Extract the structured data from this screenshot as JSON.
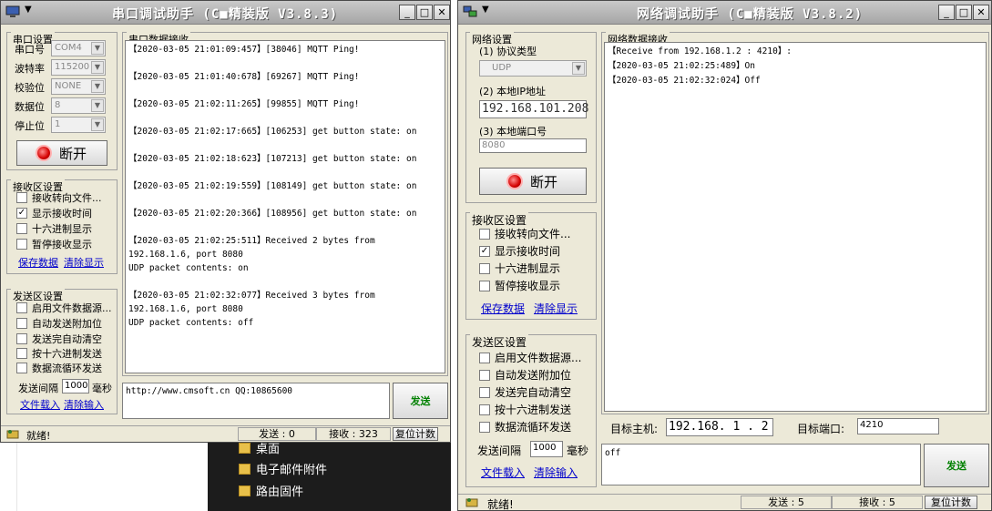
{
  "explorer": {
    "items": [
      "桌面",
      "电子邮件附件",
      "路由固件"
    ]
  },
  "serial": {
    "title": "串口调试助手  (C■精装版 V3.8.3)",
    "settings_title": "串口设置",
    "port_label": "串口号",
    "port_value": "COM4",
    "baud_label": "波特率",
    "baud_value": "115200",
    "parity_label": "校验位",
    "parity_value": "NONE",
    "data_label": "数据位",
    "data_value": "8",
    "stop_label": "停止位",
    "stop_value": "1",
    "open_button": "断开",
    "recv_title": "接收区设置",
    "recv_options": [
      {
        "label": "接收转向文件...",
        "checked": ""
      },
      {
        "label": "显示接收时间",
        "checked": "✓"
      },
      {
        "label": "十六进制显示",
        "checked": ""
      },
      {
        "label": "暂停接收显示",
        "checked": ""
      }
    ],
    "save_data": "保存数据",
    "clear_display": "清除显示",
    "send_title": "发送区设置",
    "send_options": [
      {
        "label": "启用文件数据源...",
        "checked": ""
      },
      {
        "label": "自动发送附加位",
        "checked": ""
      },
      {
        "label": "发送完自动清空",
        "checked": ""
      },
      {
        "label": "按十六进制发送",
        "checked": ""
      },
      {
        "label": "数据流循环发送",
        "checked": ""
      }
    ],
    "interval_label": "发送间隔",
    "interval_value": "1000",
    "interval_unit": "毫秒",
    "load_file": "文件载入",
    "clear_input": "清除输入",
    "data_title": "串口数据接收",
    "log": "【2020-03-05 21:01:09:457】[38046] MQTT Ping!\n\n【2020-03-05 21:01:40:678】[69267] MQTT Ping!\n\n【2020-03-05 21:02:11:265】[99855] MQTT Ping!\n\n【2020-03-05 21:02:17:665】[106253] get button state: on\n\n【2020-03-05 21:02:18:623】[107213] get button state: on\n\n【2020-03-05 21:02:19:559】[108149] get button state: on\n\n【2020-03-05 21:02:20:366】[108956] get button state: on\n\n【2020-03-05 21:02:25:511】Received 2 bytes from\n192.168.1.6, port 8080\nUDP packet contents: on\n\n【2020-03-05 21:02:32:077】Received 3 bytes from\n192.168.1.6, port 8080\nUDP packet contents: off",
    "send_text": "http://www.cmsoft.cn QQ:10865600",
    "send_button": "发送",
    "status": "就绪!",
    "sent_label": "发送 : 0",
    "recv_label": "接收 : 323",
    "reset_button": "复位计数"
  },
  "net": {
    "title": "网络调试助手  (C■精装版 V3.8.2)",
    "settings_title": "网络设置",
    "protocol_label": "(1) 协议类型",
    "protocol_value": "UDP",
    "ip_label": "(2) 本地IP地址",
    "ip_value": "192.168.101.208",
    "port_label": "(3) 本地端口号",
    "port_value": "8080",
    "open_button": "断开",
    "recv_title": "接收区设置",
    "recv_options": [
      {
        "label": "接收转向文件...",
        "checked": ""
      },
      {
        "label": "显示接收时间",
        "checked": "✓"
      },
      {
        "label": "十六进制显示",
        "checked": ""
      },
      {
        "label": "暂停接收显示",
        "checked": ""
      }
    ],
    "save_data": "保存数据",
    "clear_display": "清除显示",
    "send_title": "发送区设置",
    "send_options": [
      {
        "label": "启用文件数据源...",
        "checked": ""
      },
      {
        "label": "自动发送附加位",
        "checked": ""
      },
      {
        "label": "发送完自动清空",
        "checked": ""
      },
      {
        "label": "按十六进制发送",
        "checked": ""
      },
      {
        "label": "数据流循环发送",
        "checked": ""
      }
    ],
    "interval_label": "发送间隔",
    "interval_value": "1000",
    "interval_unit": "毫秒",
    "load_file": "文件载入",
    "clear_input": "清除输入",
    "data_title": "网络数据接收",
    "log": "【Receive from 192.168.1.2 : 4210】:\n【2020-03-05 21:02:25:489】On\n【2020-03-05 21:02:32:024】Off",
    "target_host_label": "目标主机:",
    "target_host_value": "192.168. 1 . 2",
    "target_port_label": "目标端口:",
    "target_port_value": "4210",
    "send_text": "off",
    "send_button": "发送",
    "status": "就绪!",
    "sent_label": "发送 : 5",
    "recv_label": "接收 : 5",
    "reset_button": "复位计数"
  }
}
